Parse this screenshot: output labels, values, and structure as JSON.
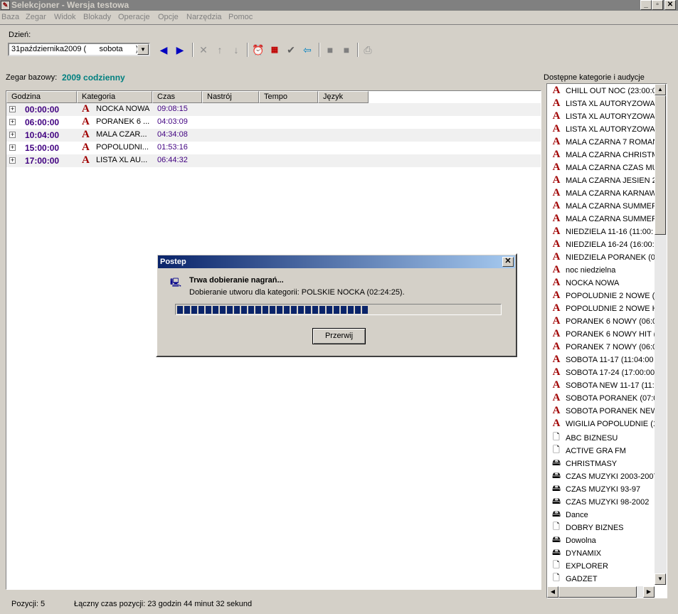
{
  "window": {
    "title": "Selekcjoner - Wersja testowa",
    "min_btn": "_",
    "max_btn": "▫",
    "close_btn": "✕"
  },
  "menu": [
    "Baza",
    "Zegar",
    "Widok",
    "Blokady",
    "Operacje",
    "Opcje",
    "Narzędzia",
    "Pomoc"
  ],
  "toolbar": {
    "day_label": "Dzień:",
    "day_value": "31października2009 (      sobota      )"
  },
  "zegar": {
    "label": "Zegar bazowy:",
    "value": "2009 codzienny"
  },
  "table": {
    "columns": [
      "Godzina",
      "Kategoria",
      "Czas",
      "Nastrój",
      "Tempo",
      "Język"
    ],
    "rows": [
      {
        "hour": "00:00:00",
        "category": "NOCKA NOWA",
        "time": "09:08:15"
      },
      {
        "hour": "06:00:00",
        "category": "PORANEK 6 ...",
        "time": "04:03:09"
      },
      {
        "hour": "10:04:00",
        "category": "MALA CZAR...",
        "time": "04:34:08"
      },
      {
        "hour": "15:00:00",
        "category": "POPOLUDNI...",
        "time": "01:53:16"
      },
      {
        "hour": "17:00:00",
        "category": "LISTA XL AU...",
        "time": "06:44:32"
      }
    ]
  },
  "status": {
    "positions": "Pozycji: 5",
    "total": "Łączny czas pozycji: 23 godzin 44 minut 32 sekund"
  },
  "right_panel": {
    "title": "Dostępne kategorie i audycje",
    "items": [
      {
        "icon": "category-a-icon",
        "label": "CHILL OUT NOC (23:00:0"
      },
      {
        "icon": "category-a-icon",
        "label": "LISTA XL AUTORYZOWA"
      },
      {
        "icon": "category-a-icon",
        "label": "LISTA XL AUTORYZOWA"
      },
      {
        "icon": "category-a-icon",
        "label": "LISTA XL AUTORYZOWA"
      },
      {
        "icon": "category-a-icon",
        "label": "MALA CZARNA 7 ROMAN"
      },
      {
        "icon": "category-a-icon",
        "label": "MALA CZARNA CHRISTM"
      },
      {
        "icon": "category-a-icon",
        "label": "MALA CZARNA CZAS MU"
      },
      {
        "icon": "category-a-icon",
        "label": "MALA CZARNA JESIEN 2"
      },
      {
        "icon": "category-a-icon",
        "label": "MALA CZARNA KARNAW"
      },
      {
        "icon": "category-a-icon",
        "label": "MALA CZARNA SUMMEF"
      },
      {
        "icon": "category-a-icon",
        "label": "MALA CZARNA SUMMEF"
      },
      {
        "icon": "category-a-icon",
        "label": "NIEDZIELA 11-16 (11:00:"
      },
      {
        "icon": "category-a-icon",
        "label": "NIEDZIELA 16-24 (16:00:"
      },
      {
        "icon": "category-a-icon",
        "label": "NIEDZIELA PORANEK (0"
      },
      {
        "icon": "category-a-icon",
        "label": "noc niedzielna"
      },
      {
        "icon": "category-a-icon",
        "label": "NOCKA NOWA"
      },
      {
        "icon": "category-a-icon",
        "label": "POPOLUDNIE 2 NOWE ("
      },
      {
        "icon": "category-a-icon",
        "label": "POPOLUDNIE 2 NOWE H"
      },
      {
        "icon": "category-a-icon",
        "label": "PORANEK 6 NOWY (06:0"
      },
      {
        "icon": "category-a-icon",
        "label": "PORANEK 6 NOWY HIT ("
      },
      {
        "icon": "category-a-icon",
        "label": "PORANEK 7 NOWY (06:0"
      },
      {
        "icon": "category-a-icon",
        "label": "SOBOTA 11-17 (11:04:00"
      },
      {
        "icon": "category-a-icon",
        "label": "SOBOTA 17-24 (17:00:00"
      },
      {
        "icon": "category-a-icon",
        "label": "SOBOTA NEW 11-17 (11:"
      },
      {
        "icon": "category-a-icon",
        "label": "SOBOTA PORANEK (07:0"
      },
      {
        "icon": "category-a-icon",
        "label": "SOBOTA PORANEK NEW"
      },
      {
        "icon": "category-a-icon",
        "label": "WIGILIA POPOLUDNIE (1"
      },
      {
        "icon": "document-icon",
        "label": "ABC BIZNESU"
      },
      {
        "icon": "document-icon",
        "label": "ACTIVE GRA FM"
      },
      {
        "icon": "disk-stack-icon",
        "label": "CHRISTMASY"
      },
      {
        "icon": "disk-stack-icon",
        "label": "CZAS MUZYKI 2003-2007"
      },
      {
        "icon": "disk-stack-icon",
        "label": "CZAS MUZYKI 93-97"
      },
      {
        "icon": "disk-stack-icon",
        "label": "CZAS MUZYKI 98-2002"
      },
      {
        "icon": "disk-stack-icon",
        "label": "Dance"
      },
      {
        "icon": "document-icon",
        "label": "DOBRY BIZNES"
      },
      {
        "icon": "disk-stack-icon",
        "label": "Dowolna"
      },
      {
        "icon": "disk-stack-icon",
        "label": "DYNAMIX"
      },
      {
        "icon": "document-icon",
        "label": "EXPLORER"
      },
      {
        "icon": "document-icon",
        "label": "GADZET"
      }
    ]
  },
  "dialog": {
    "title": "Postep",
    "heading": "Trwa dobieranie nagrań...",
    "subtext": "Dobieranie utworu dla kategorii: POLSKIE NOCKA  (02:24:25).",
    "progress_fraction": 0.59,
    "cancel_label": "Przerwij"
  },
  "colors": {
    "hour_text": "#400080",
    "category_icon": "#a00000",
    "zegar_value": "#008080",
    "progress_block": "#0a246a"
  }
}
